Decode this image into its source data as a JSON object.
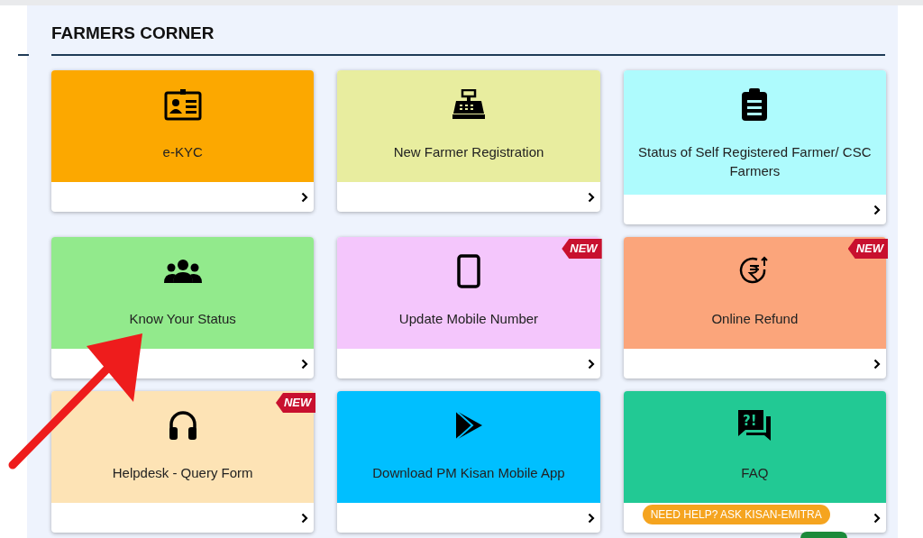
{
  "section_title": "FARMERS CORNER",
  "cards": [
    {
      "label": "e-KYC",
      "color": "#fca800"
    },
    {
      "label": "New Farmer Registration",
      "color": "#e8ed9f"
    },
    {
      "label": "Status of Self Registered Farmer/ CSC Farmers",
      "color": "#aefbfd"
    },
    {
      "label": "Know Your Status",
      "color": "#92ea8c"
    },
    {
      "label": "Update Mobile Number",
      "color": "#f4c6fc",
      "badge": "NEW"
    },
    {
      "label": "Online Refund",
      "color": "#fba57b",
      "badge": "NEW"
    },
    {
      "label": "Helpdesk - Query Form",
      "color": "#fde3b5",
      "badge": "NEW"
    },
    {
      "label": "Download PM Kisan Mobile App",
      "color": "#00bfff"
    },
    {
      "label": "FAQ",
      "color": "#22c994",
      "icon_text": "?!",
      "help_chip": "NEED HELP? ASK KISAN-EMITRA"
    }
  ]
}
